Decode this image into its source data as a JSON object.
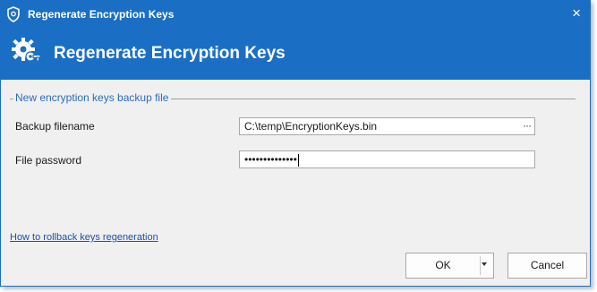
{
  "window": {
    "title": "Regenerate Encryption Keys",
    "close_glyph": "×",
    "app_icon": "shield-icon"
  },
  "banner": {
    "title": "Regenerate Encryption Keys",
    "icon": "gear-key-icon"
  },
  "section": {
    "label": "New encryption keys backup file"
  },
  "fields": {
    "backup_label": "Backup filename",
    "backup_value": "C:\\temp\\EncryptionKeys.bin",
    "browse_glyph": "···",
    "password_label": "File password",
    "password_mask": "••••••••••••••"
  },
  "link": {
    "text": "How to rollback keys regeneration"
  },
  "buttons": {
    "ok": "OK",
    "cancel": "Cancel"
  },
  "colors": {
    "header_blue": "#1a6fc4",
    "section_blue": "#2a6cc0",
    "link_blue": "#1a4fb0",
    "dialog_bg": "#f0f0f0"
  }
}
